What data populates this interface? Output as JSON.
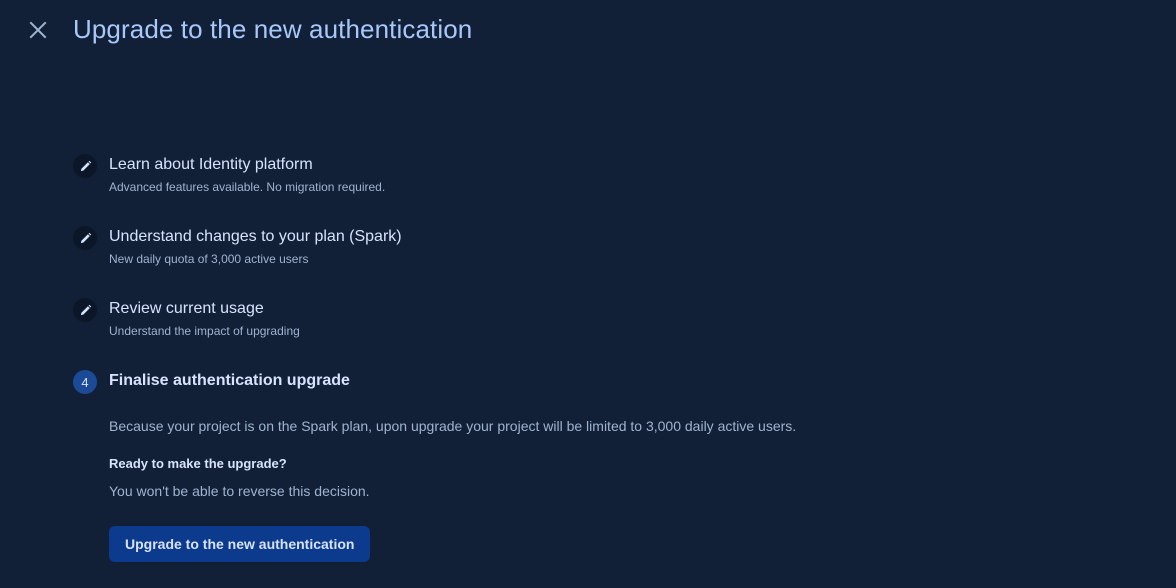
{
  "header": {
    "title": "Upgrade to the new authentication",
    "close_icon": "close-icon"
  },
  "steps": [
    {
      "title": "Learn about Identity platform",
      "subtitle": "Advanced features available. No migration required.",
      "icon": "pencil-icon",
      "state": "completed"
    },
    {
      "title": "Understand changes to your plan (Spark)",
      "subtitle": "New daily quota of 3,000 active users",
      "icon": "pencil-icon",
      "state": "completed"
    },
    {
      "title": "Review current usage",
      "subtitle": "Understand the impact of upgrading",
      "icon": "pencil-icon",
      "state": "completed"
    },
    {
      "number": "4",
      "title": "Finalise authentication upgrade",
      "state": "active"
    }
  ],
  "active_step": {
    "description": "Because your project is on the Spark plan, upon upgrade your project will be limited to 3,000 daily active users.",
    "ready_heading": "Ready to make the upgrade?",
    "warning": "You won't be able to reverse this decision.",
    "button_label": "Upgrade to the new authentication"
  },
  "colors": {
    "background": "#112037",
    "title": "#a8c7fa",
    "button": "#0c3a8c",
    "active_step_badge": "#1c4a97"
  }
}
